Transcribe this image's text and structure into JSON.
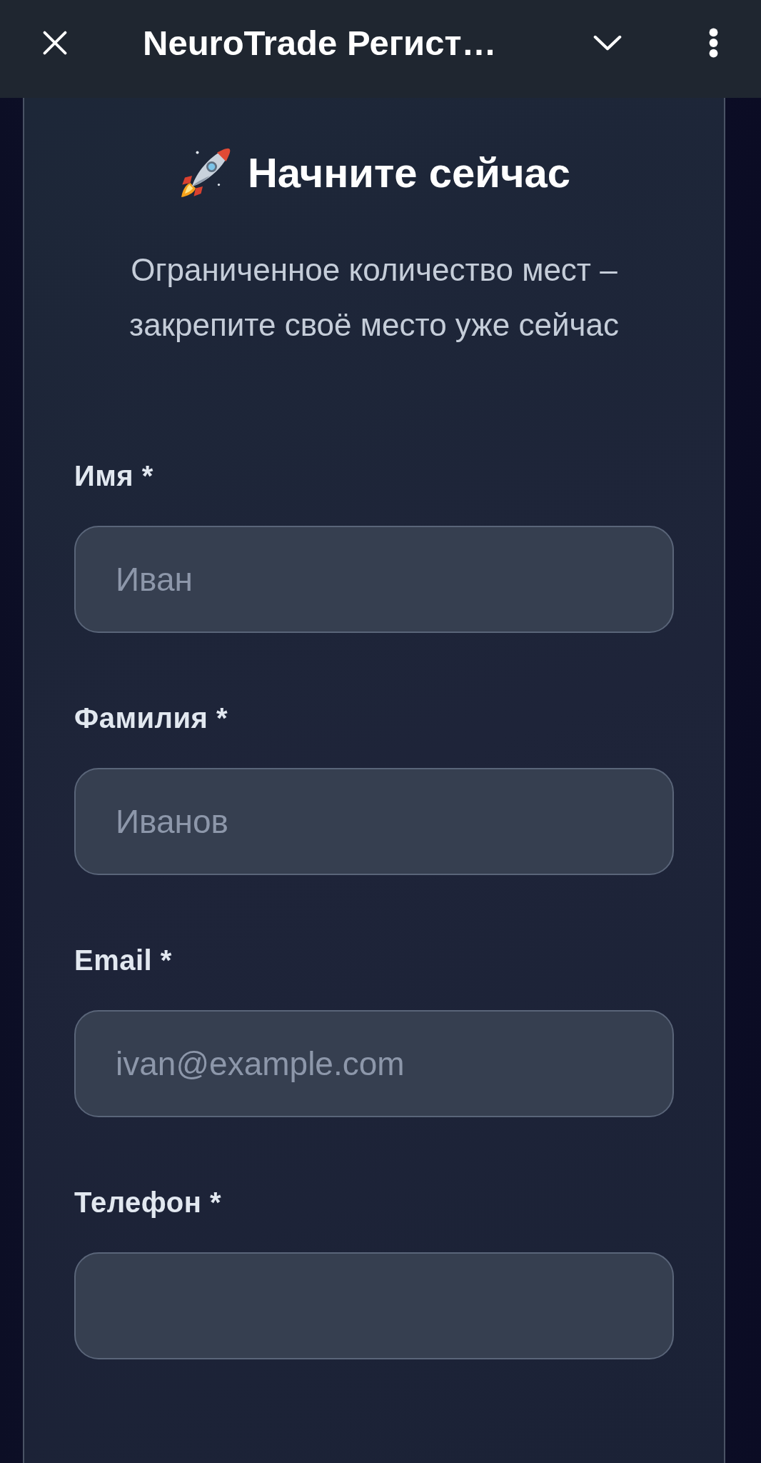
{
  "top_bar": {
    "title": "NeuroTrade Регист…"
  },
  "form": {
    "heading": "Начните сейчас",
    "subtitle": "Ограниченное количество мест – закрепите своё место уже сейчас",
    "fields": [
      {
        "label": "Имя *",
        "placeholder": "Иван"
      },
      {
        "label": "Фамилия *",
        "placeholder": "Иванов"
      },
      {
        "label": "Email *",
        "placeholder": "ivan@example.com"
      },
      {
        "label": "Телефон *"
      }
    ]
  }
}
